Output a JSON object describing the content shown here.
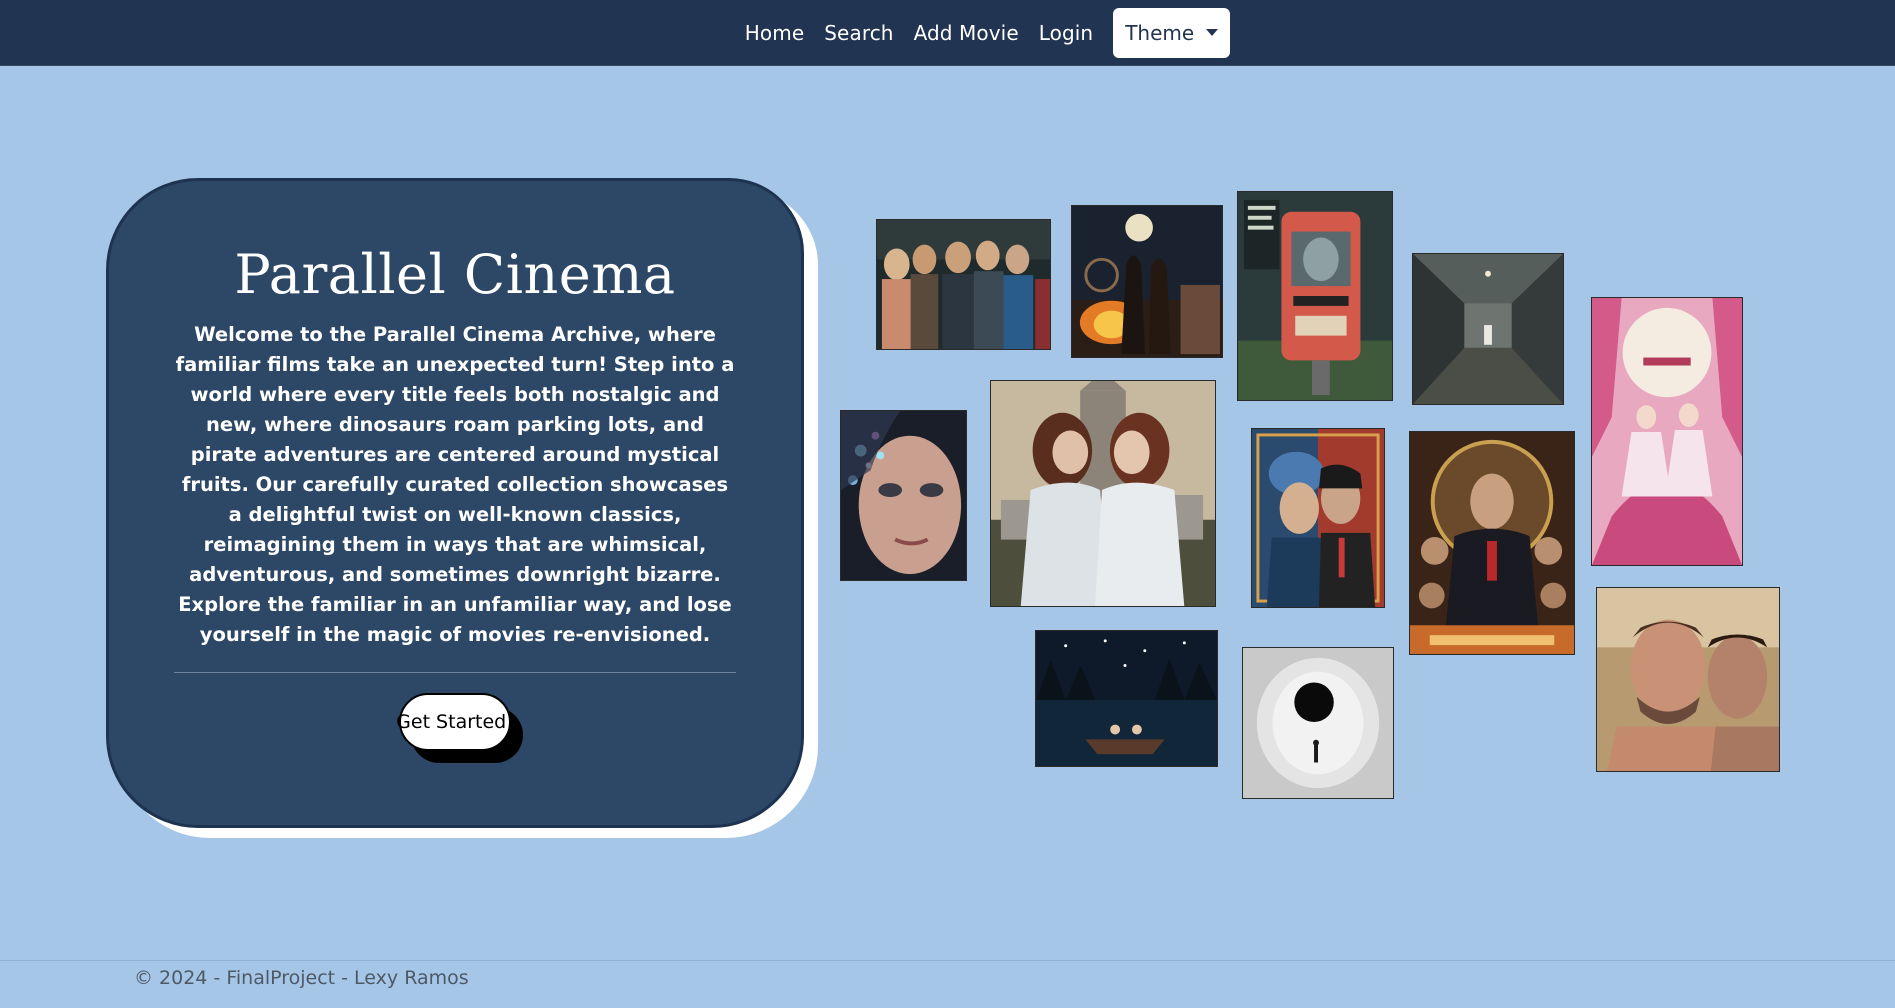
{
  "nav": {
    "items": [
      {
        "label": "Home"
      },
      {
        "label": "Search"
      },
      {
        "label": "Add Movie"
      },
      {
        "label": "Login"
      }
    ],
    "theme_label": "Theme",
    "theme_icon": "chevron-down-icon"
  },
  "hero": {
    "title": "Parallel Cinema",
    "text": "Welcome to the Parallel Cinema Archive, where familiar films take an unexpected turn! Step into a world where every title feels both nostalgic and new, where dinosaurs roam parking lots, and pirate adventures are centered around mystical fruits. Our carefully curated collection showcases a delightful twist on well-known classics, reimagining them in ways that are whimsical, adventurous, and sometimes downright bizarre. Explore the familiar in an unfamiliar way, and lose yourself in the magic of movies re-envisioned.",
    "cta_label": "Get Started!"
  },
  "posters": [
    {
      "subject": "group-of-characters-poster"
    },
    {
      "subject": "moonlit-bonfire-poster"
    },
    {
      "subject": "mailbox-poster"
    },
    {
      "subject": "hallway-poster"
    },
    {
      "subject": "pink-dancers-poster"
    },
    {
      "subject": "sparkle-face-poster"
    },
    {
      "subject": "two-women-cemetery-poster"
    },
    {
      "subject": "split-face-poster"
    },
    {
      "subject": "godfather-style-poster"
    },
    {
      "subject": "night-lake-boat-poster"
    },
    {
      "subject": "black-circle-poster"
    },
    {
      "subject": "two-men-portrait-poster"
    }
  ],
  "footer": {
    "text": "© 2024 - FinalProject - Lexy Ramos"
  },
  "colors": {
    "navbar": "#213552",
    "background": "#a6c6e8",
    "card": "#2d4766"
  }
}
